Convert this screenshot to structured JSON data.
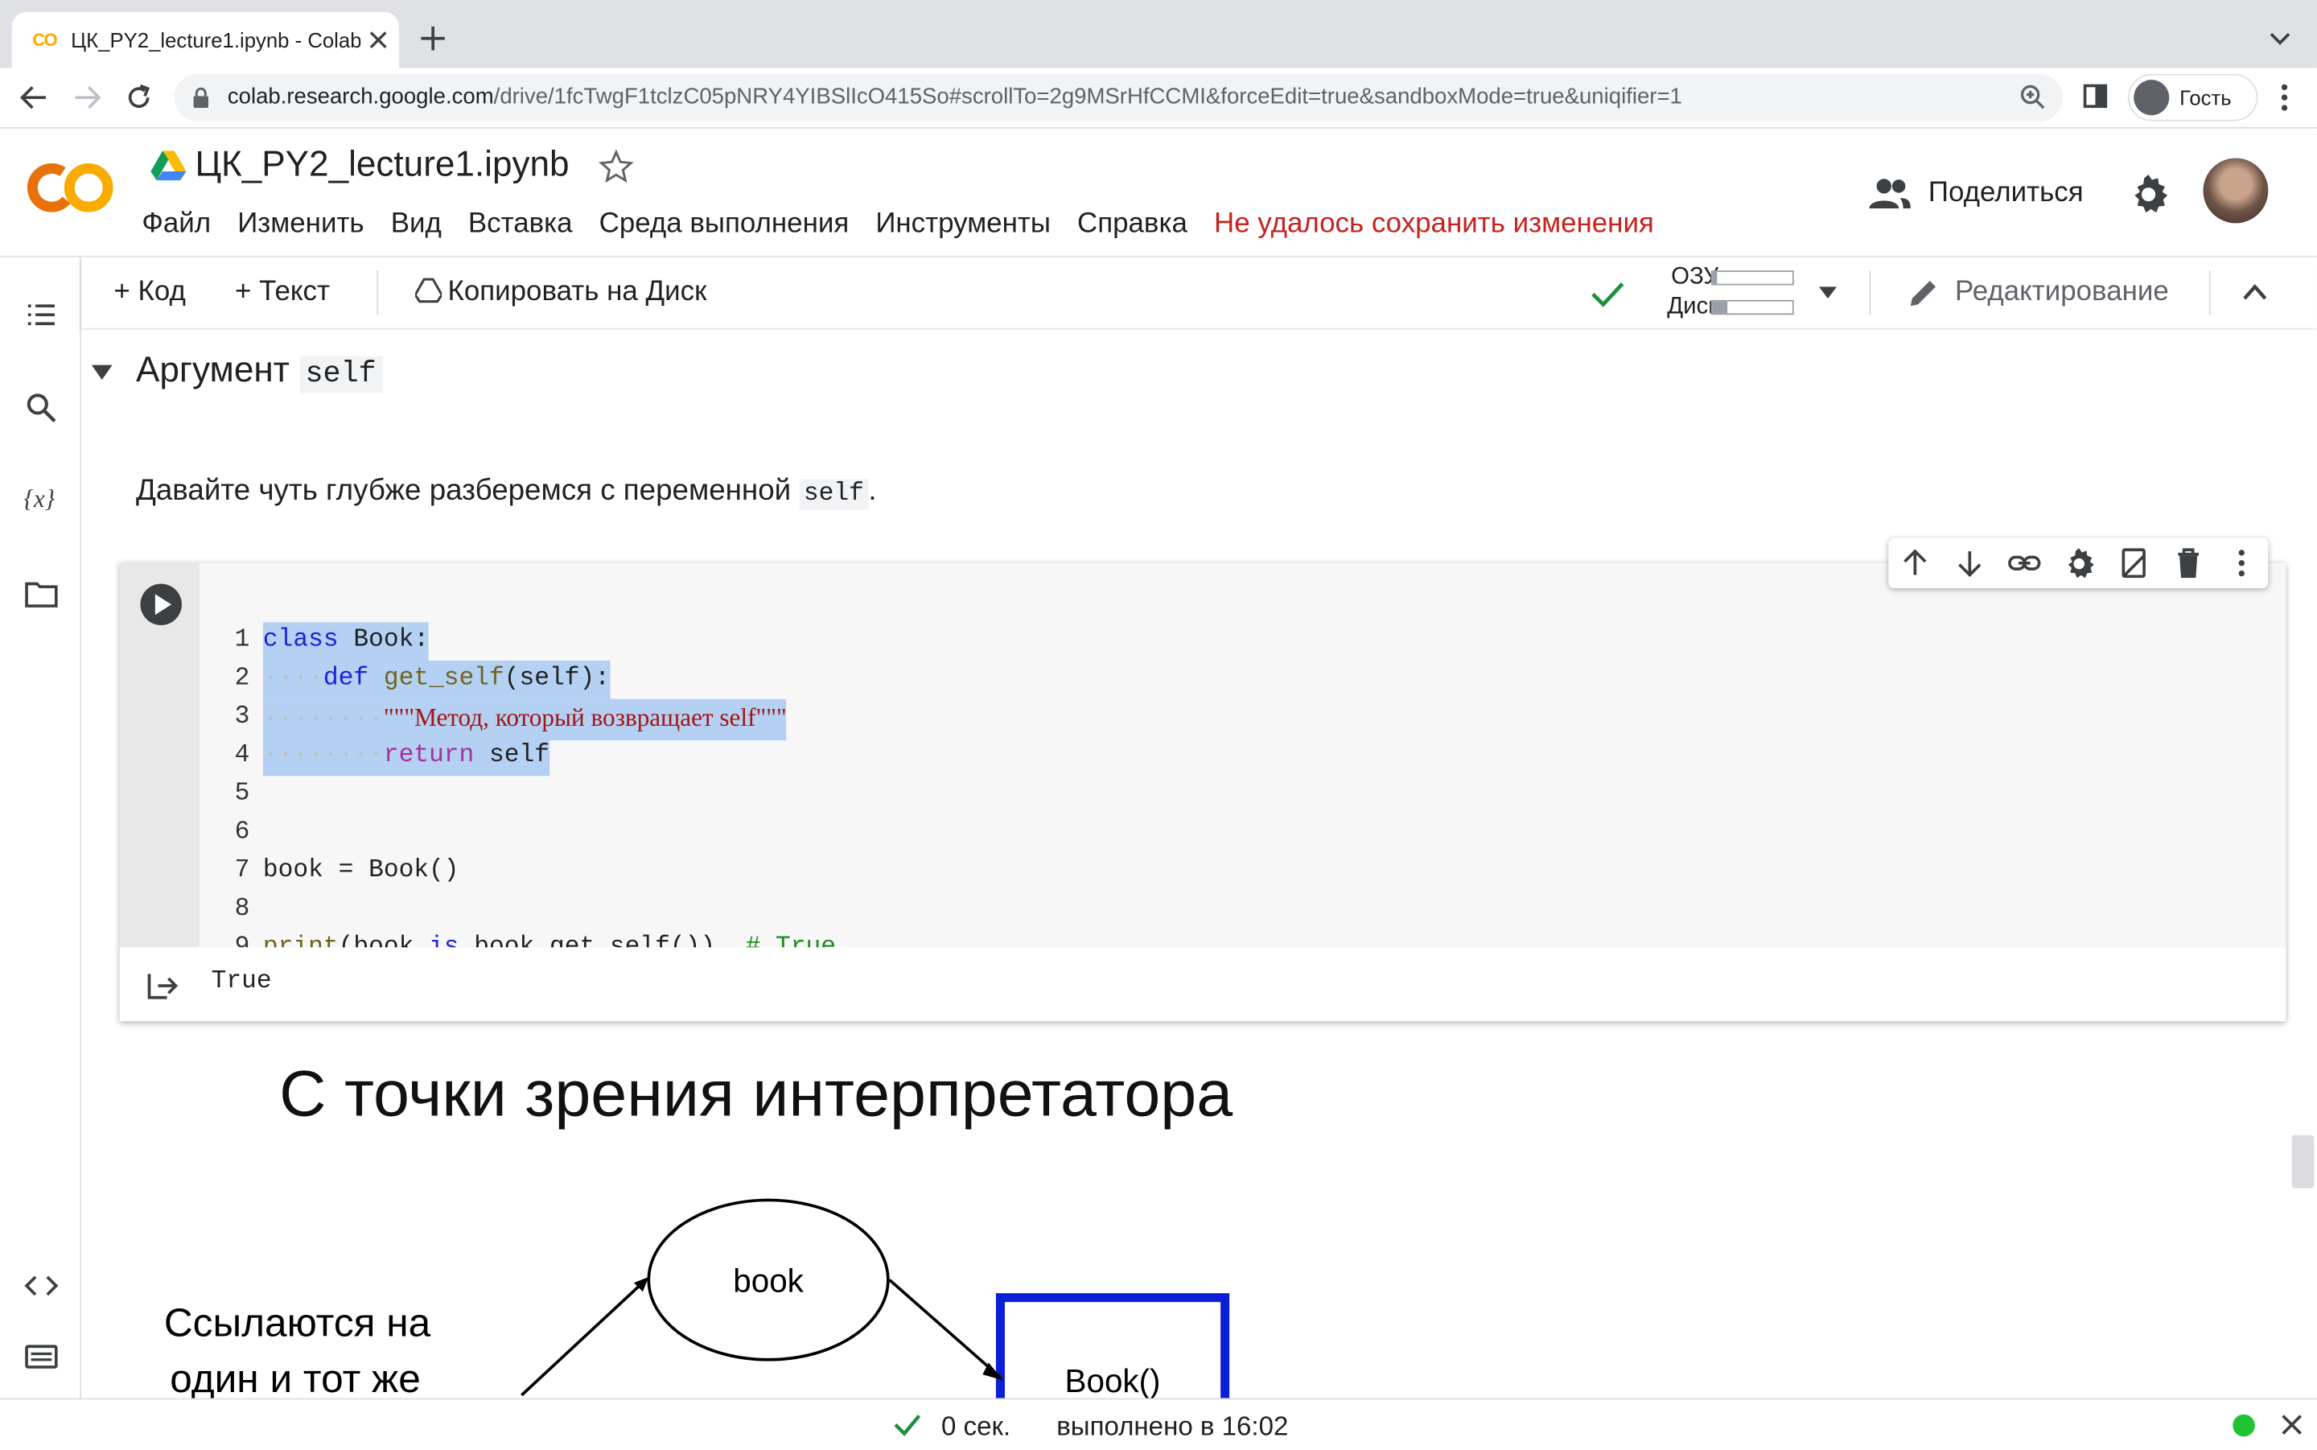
{
  "browser": {
    "tab_title": "ЦК_PY2_lecture1.ipynb - Colab",
    "tab_favicon_text": "CO",
    "url_host": "colab.research.google.com",
    "url_path": "/drive/1fcTwgF1tclzC05pNRY4YIBSlIcO415So#scrollTo=2g9MSrHfCCMI&forceEdit=true&sandboxMode=true&uniqifier=1",
    "profile_label": "Гость"
  },
  "header": {
    "notebook_title": "ЦК_PY2_lecture1.ipynb",
    "menu": [
      "Файл",
      "Изменить",
      "Вид",
      "Вставка",
      "Среда выполнения",
      "Инструменты",
      "Справка"
    ],
    "save_warning": "Не удалось сохранить изменения",
    "share_label": "Поделиться"
  },
  "toolbar": {
    "add_code": "+ Код",
    "add_text": "+ Текст",
    "copy_to_drive": "Копировать на Диск",
    "ram_label": "ОЗУ",
    "disk_label": "Диск",
    "ram_fraction": 0.05,
    "disk_fraction": 0.18,
    "edit_mode": "Редактирование"
  },
  "section": {
    "heading_text": "Аргумент",
    "heading_code": "self",
    "paragraph_text": "Давайте чуть глубже разберемся с переменной",
    "paragraph_code": "self",
    "paragraph_end": "."
  },
  "code_cell": {
    "line_numbers": [
      "1",
      "2",
      "3",
      "4",
      "5",
      "6",
      "7",
      "8",
      "9"
    ],
    "l1": [
      "class",
      " Book:"
    ],
    "l2": [
      "def",
      " ",
      "get_self",
      "(self):"
    ],
    "l3": "\"\"\"Метод, который возвращает self\"\"\"",
    "l4": [
      "return",
      " self"
    ],
    "l7": "book = Book()",
    "l9": [
      "print",
      "(book ",
      "is",
      " book.get_self())  ",
      "# True"
    ],
    "output": "True"
  },
  "slide": {
    "title": "С точки зрения интерпретатора",
    "node_book": "book",
    "node_instance": "Book()",
    "side_text_1": "Ссылаются на",
    "side_text_2": "один и тот же"
  },
  "status": {
    "duration": "0 сек.",
    "completed": "выполнено в 16:02"
  },
  "colors": {
    "accent_warning": "#c5221f",
    "status_ok": "#1ec431",
    "selection": "#b4d0f2"
  }
}
